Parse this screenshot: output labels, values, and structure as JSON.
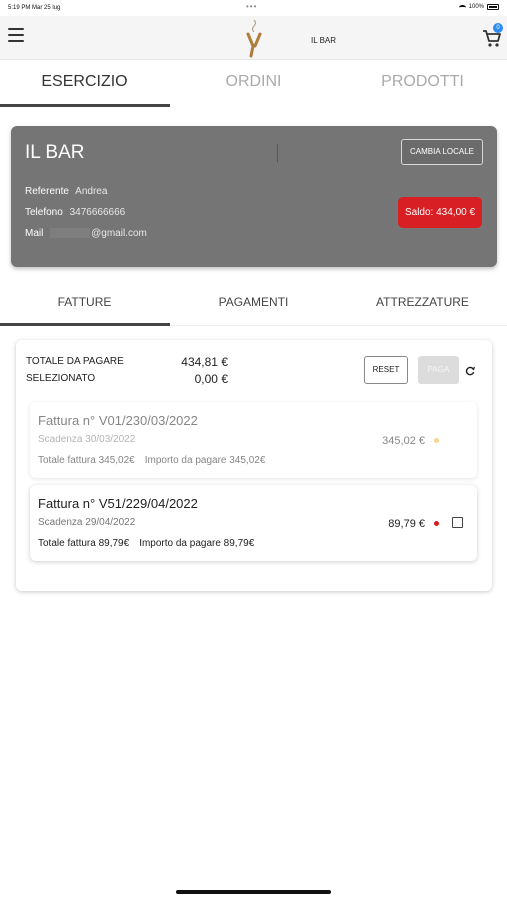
{
  "status_bar": {
    "time_date": "5:19 PM  Mar 25 lug",
    "battery": "100%",
    "dots": "•••"
  },
  "app_bar": {
    "title": "IL BAR",
    "cart_count": "0"
  },
  "top_tabs": [
    {
      "label": "ESERCIZIO",
      "active": true
    },
    {
      "label": "ORDINI",
      "active": false
    },
    {
      "label": "PRODOTTI",
      "active": false
    }
  ],
  "store": {
    "name": "IL BAR",
    "referente_label": "Referente",
    "referente_value": "Andrea",
    "telefono_label": "Telefono",
    "telefono_value": "3476666666",
    "mail_label": "Mail",
    "mail_value": "@gmail.com",
    "change_button": "CAMBIA LOCALE",
    "saldo": "Saldo: 434,00 €"
  },
  "sub_tabs": [
    {
      "label": "FATTURE",
      "active": true
    },
    {
      "label": "PAGAMENTI",
      "active": false
    },
    {
      "label": "ATTREZZATURE",
      "active": false
    }
  ],
  "totals": {
    "total_label": "TOTALE DA PAGARE",
    "total_value": "434,81 €",
    "selected_label": "SELEZIONATO",
    "selected_value": "0,00 €",
    "reset_button": "RESET",
    "pay_button": "PAGA"
  },
  "invoices": [
    {
      "title": "Fattura n° V01/230/03/2022",
      "due": "Scadenza 30/03/2022",
      "total": "Totale fattura 345,02€",
      "to_pay": "Importo da pagare 345,02€",
      "amount": "345,02 €",
      "status_color": "#f2b134",
      "disabled": true
    },
    {
      "title": "Fattura n° V51/229/04/2022",
      "due": "Scadenza 29/04/2022",
      "total": "Totale fattura 89,79€",
      "to_pay": "Importo da pagare 89,79€",
      "amount": "89,79 €",
      "status_color": "#d71f24",
      "disabled": false
    }
  ],
  "colors": {
    "accent_red": "#d71f24",
    "card_gray": "#757575",
    "badge_blue": "#2d8cf0"
  }
}
